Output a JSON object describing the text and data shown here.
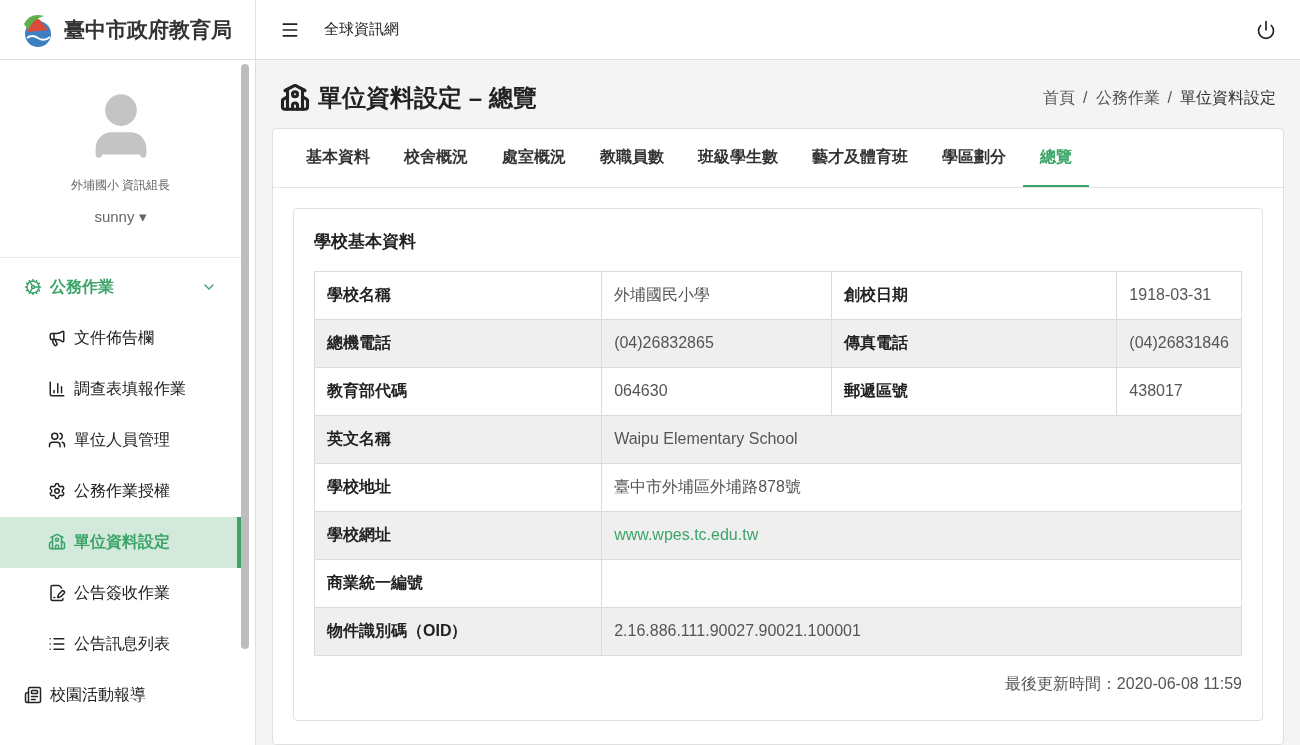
{
  "brand": {
    "title": "臺中市政府教育局"
  },
  "user": {
    "unit": "外埔國小 資訊組長",
    "name": "sunny",
    "caret": "▾"
  },
  "sidebar": {
    "items": [
      {
        "label": "公務作業",
        "expanded": true,
        "selected": false,
        "children": [
          {
            "label": "文件佈告欄",
            "selected": false
          },
          {
            "label": "調查表填報作業",
            "selected": false
          },
          {
            "label": "單位人員管理",
            "selected": false
          },
          {
            "label": "公務作業授權",
            "selected": false
          },
          {
            "label": "單位資料設定",
            "selected": true
          },
          {
            "label": "公告簽收作業",
            "selected": false
          },
          {
            "label": "公告訊息列表",
            "selected": false
          }
        ]
      },
      {
        "label": "校園活動報導",
        "selected": false
      }
    ]
  },
  "topbar": {
    "title": "全球資訊網"
  },
  "page": {
    "title": "單位資料設定 – 總覽",
    "breadcrumb": [
      {
        "kind": "link",
        "text": "首頁"
      },
      {
        "kind": "separator",
        "text": "/"
      },
      {
        "kind": "link",
        "text": "公務作業"
      },
      {
        "kind": "separator",
        "text": "/"
      },
      {
        "kind": "current",
        "text": "單位資料設定"
      }
    ]
  },
  "tabs": [
    {
      "label": "基本資料",
      "selected": false
    },
    {
      "label": "校舍概況",
      "selected": false
    },
    {
      "label": "處室概況",
      "selected": false
    },
    {
      "label": "教職員數",
      "selected": false
    },
    {
      "label": "班級學生數",
      "selected": false
    },
    {
      "label": "藝才及體育班",
      "selected": false
    },
    {
      "label": "學區劃分",
      "selected": false
    },
    {
      "label": "總覽",
      "selected": true
    }
  ],
  "section": {
    "title": "學校基本資料",
    "rows": [
      {
        "kind": "pair",
        "cells": [
          {
            "label": "學校名稱",
            "value": "外埔國民小學"
          },
          {
            "label": "創校日期",
            "value": "1918-03-31"
          }
        ]
      },
      {
        "kind": "pair",
        "cells": [
          {
            "label": "總機電話",
            "value": "(04)26832865"
          },
          {
            "label": "傳真電話",
            "value": "(04)26831846"
          }
        ]
      },
      {
        "kind": "pair",
        "cells": [
          {
            "label": "教育部代碼",
            "value": "064630"
          },
          {
            "label": "郵遞區號",
            "value": "438017"
          }
        ]
      },
      {
        "kind": "single",
        "cells": [
          {
            "label": "英文名稱",
            "value": "Waipu Elementary School"
          }
        ]
      },
      {
        "kind": "single",
        "cells": [
          {
            "label": "學校地址",
            "value": "臺中市外埔區外埔路878號"
          }
        ]
      },
      {
        "kind": "link",
        "cells": [
          {
            "label": "學校網址",
            "value": "www.wpes.tc.edu.tw"
          }
        ]
      },
      {
        "kind": "single",
        "cells": [
          {
            "label": "商業統一編號"
          }
        ]
      },
      {
        "kind": "single",
        "cells": [
          {
            "label": "物件識別碼（OID）",
            "value": "2.16.886.111.90027.90021.100001"
          }
        ]
      }
    ],
    "updated": "最後更新時間：2020-06-08 11:59"
  }
}
